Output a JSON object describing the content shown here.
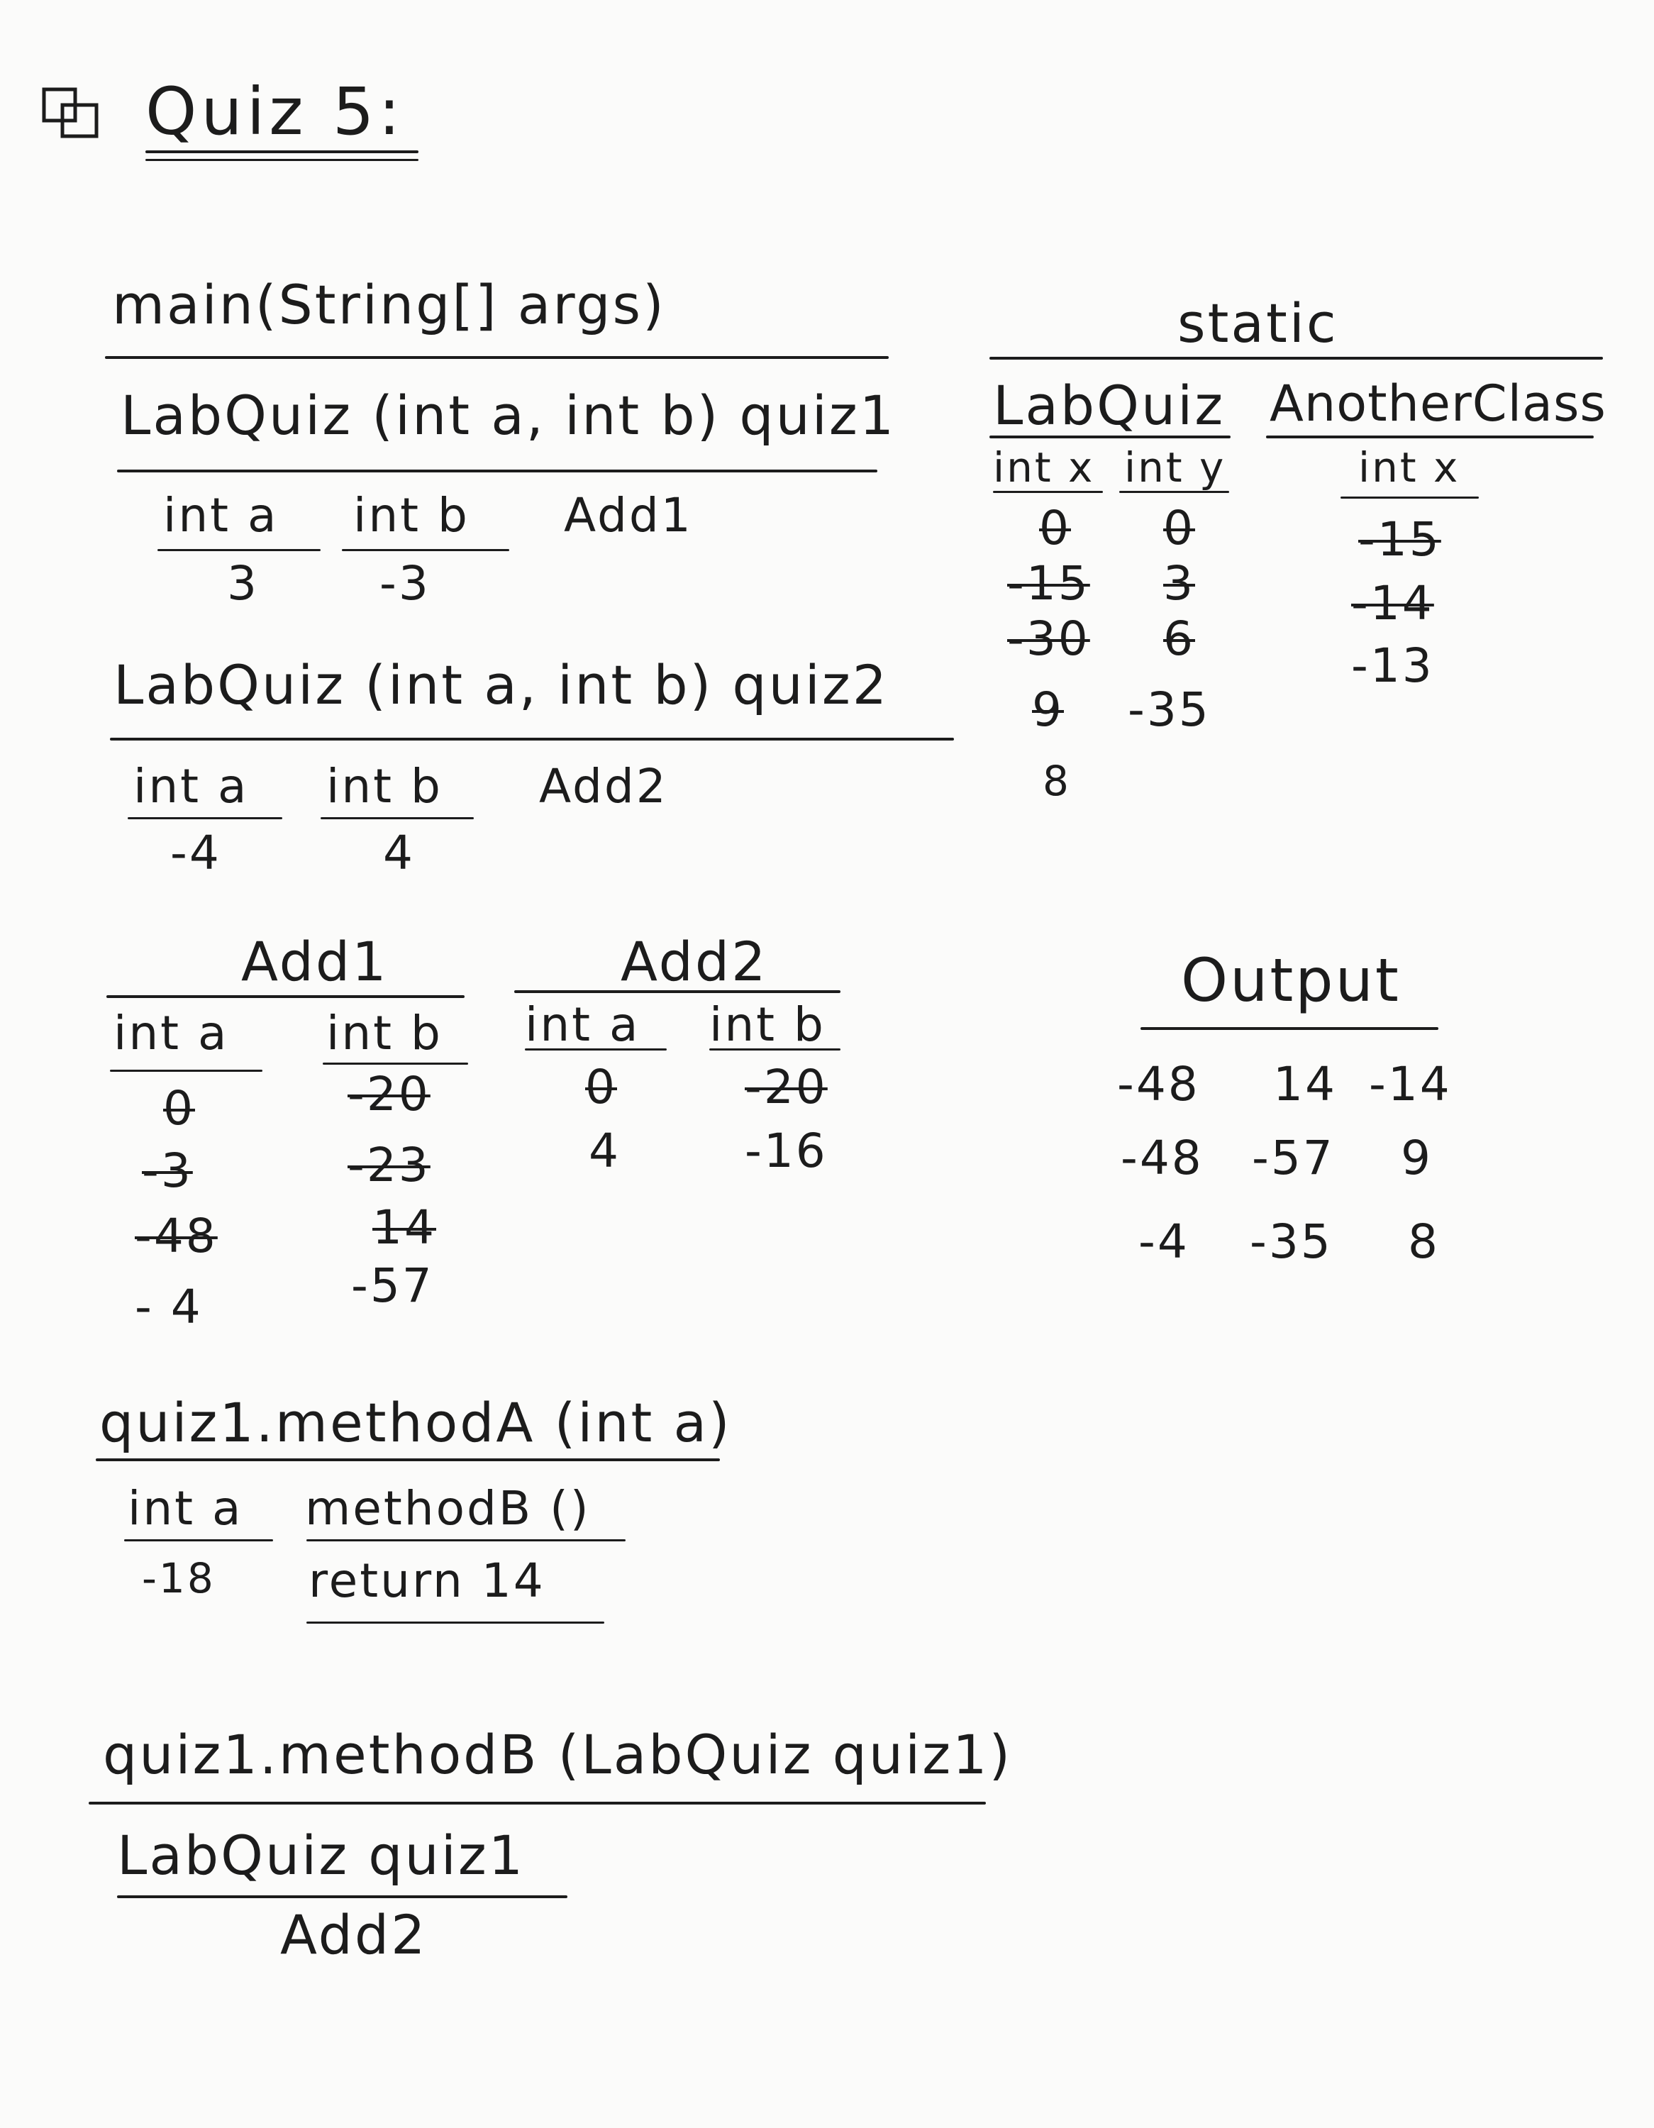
{
  "title": "Quiz 5:",
  "icon": "stack-squares-icon",
  "main": {
    "header": "main(String[] args)",
    "quiz1": {
      "header": "LabQuiz (int a, int b) quiz1",
      "col1": "int a",
      "col2": "int b",
      "ref": "Add1",
      "val1": "3",
      "val2": "-3"
    },
    "quiz2": {
      "header": "LabQuiz (int a, int b) quiz2",
      "col1": "int a",
      "col2": "int b",
      "ref": "Add2",
      "val1": "-4",
      "val2": "4"
    }
  },
  "static": {
    "header": "static",
    "labquiz": {
      "title": "LabQuiz",
      "col_x": "int x",
      "col_y": "int y",
      "x_values": [
        "0",
        "-15",
        "-30",
        "9",
        "8"
      ],
      "y_values": [
        "0",
        "3",
        "6",
        "-35"
      ]
    },
    "anotherclass": {
      "title": "AnotherClass",
      "col_x": "int x",
      "x_values": [
        "-15",
        "-14",
        "-13"
      ]
    }
  },
  "add1": {
    "title": "Add1",
    "col_a": "int a",
    "col_b": "int b",
    "a_values": [
      "0",
      "-3",
      "-48",
      "- 4"
    ],
    "b_values": [
      "-20",
      "-23",
      "14",
      "-57"
    ]
  },
  "add2": {
    "title": "Add2",
    "col_a": "int a",
    "col_b": "int b",
    "a_values": [
      "0",
      "4"
    ],
    "b_values": [
      "-20",
      "-16"
    ]
  },
  "output": {
    "title": "Output",
    "rows": [
      [
        "-48",
        "14",
        "-14"
      ],
      [
        "-48",
        "-57",
        "9"
      ],
      [
        "-4",
        "-35",
        "8"
      ]
    ]
  },
  "method_a": {
    "header": "quiz1.methodA (int a)",
    "col_a": "int a",
    "a_value": "-18",
    "col_b": "methodB ()",
    "b_value": "return 14"
  },
  "method_b": {
    "header": "quiz1.methodB (LabQuiz quiz1)",
    "param": "LabQuiz quiz1",
    "value": "Add2"
  }
}
